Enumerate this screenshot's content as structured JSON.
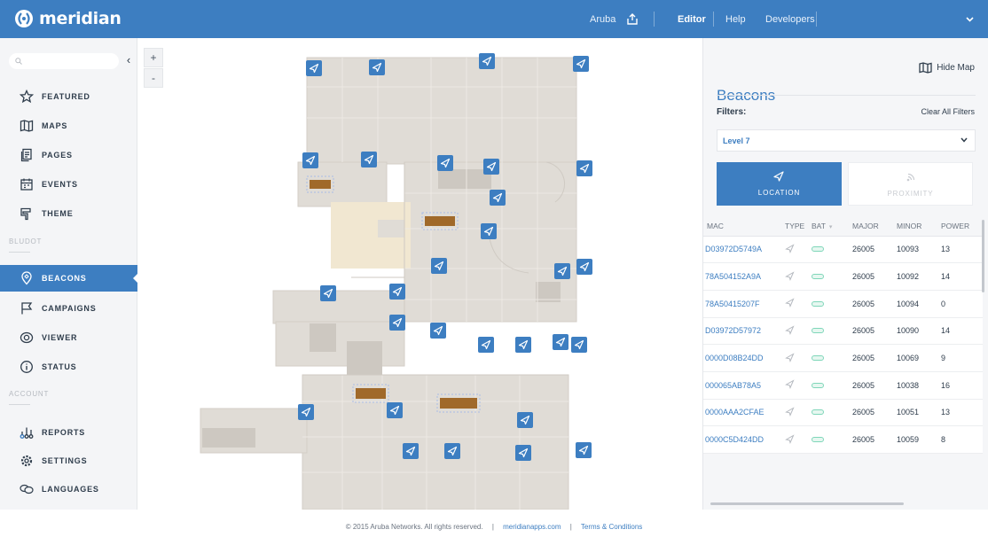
{
  "brand": {
    "name": "meridian"
  },
  "topnav": {
    "aruba": "Aruba",
    "editor": "Editor",
    "help": "Help",
    "developers": "Developers"
  },
  "colors": {
    "primary": "#3d7ec1",
    "text": "#2f3d4c",
    "sidebar_bg": "#f4f5f7",
    "battery": "#7fd6b9"
  },
  "sidebar": {
    "search_placeholder": "",
    "items": [
      {
        "label": "FEATURED",
        "icon": "star-icon"
      },
      {
        "label": "MAPS",
        "icon": "map-icon"
      },
      {
        "label": "PAGES",
        "icon": "pages-icon"
      },
      {
        "label": "EVENTS",
        "icon": "events-icon"
      },
      {
        "label": "THEME",
        "icon": "theme-icon"
      }
    ],
    "section1": "BLUDOT",
    "items2": [
      {
        "label": "BEACONS",
        "icon": "beacon-icon",
        "active": true
      },
      {
        "label": "CAMPAIGNS",
        "icon": "flag-icon"
      },
      {
        "label": "VIEWER",
        "icon": "eye-icon"
      },
      {
        "label": "STATUS",
        "icon": "info-icon"
      }
    ],
    "section2": "ACCOUNT",
    "items3": [
      {
        "label": "REPORTS",
        "icon": "reports-icon"
      },
      {
        "label": "SETTINGS",
        "icon": "gear-icon"
      },
      {
        "label": "LANGUAGES",
        "icon": "languages-icon"
      }
    ]
  },
  "map": {
    "zoom_in": "+",
    "zoom_out": "-"
  },
  "panel": {
    "title": "Beacons",
    "hide_map": "Hide Map",
    "filters_label": "Filters:",
    "clear_filters": "Clear All Filters",
    "level": "Level 7",
    "toggle_location": "LOCATION",
    "toggle_proximity": "PROXIMITY",
    "columns": [
      "MAC",
      "TYPE",
      "BAT",
      "MAJOR",
      "MINOR",
      "POWER"
    ],
    "rows": [
      {
        "mac": "D03972D5749A",
        "major": "26005",
        "minor": "10093",
        "power": "13"
      },
      {
        "mac": "78A504152A9A",
        "major": "26005",
        "minor": "10092",
        "power": "14"
      },
      {
        "mac": "78A50415207F",
        "major": "26005",
        "minor": "10094",
        "power": "0"
      },
      {
        "mac": "D03972D57972",
        "major": "26005",
        "minor": "10090",
        "power": "14"
      },
      {
        "mac": "0000D08B24DD",
        "major": "26005",
        "minor": "10069",
        "power": "9"
      },
      {
        "mac": "000065AB78A5",
        "major": "26005",
        "minor": "10038",
        "power": "16"
      },
      {
        "mac": "0000AAA2CFAE",
        "major": "26005",
        "minor": "10051",
        "power": "13"
      },
      {
        "mac": "0000C5D424DD",
        "major": "26005",
        "minor": "10059",
        "power": "8"
      }
    ]
  },
  "footer": {
    "copyright": "© 2015 Aruba Networks. All rights reserved.",
    "divider": "|",
    "link1": "meridianapps.com",
    "link2": "Terms & Conditions"
  }
}
